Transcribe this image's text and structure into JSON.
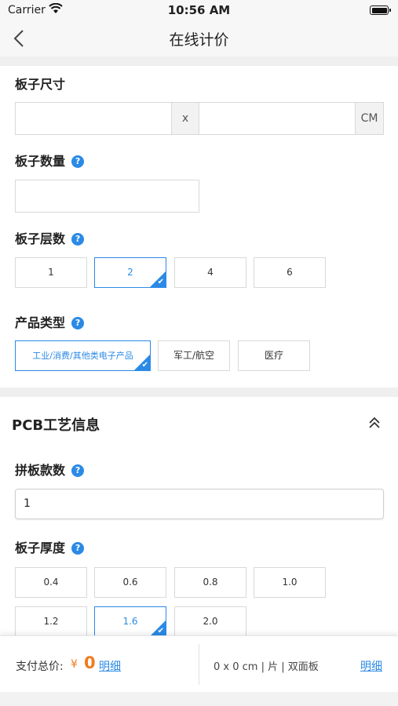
{
  "status_bar": {
    "carrier": "Carrier",
    "time": "10:56 AM"
  },
  "nav": {
    "title": "在线计价"
  },
  "board_size": {
    "label": "板子尺寸",
    "separator": "x",
    "unit": "CM",
    "width_value": "",
    "height_value": ""
  },
  "board_quantity": {
    "label": "板子数量",
    "value": ""
  },
  "board_layers": {
    "label": "板子层数",
    "options": [
      "1",
      "2",
      "4",
      "6"
    ],
    "selected": "2"
  },
  "product_type": {
    "label": "产品类型",
    "options": [
      "工业/消费/其他类电子产品",
      "军工/航空",
      "医疗"
    ],
    "selected": "工业/消费/其他类电子产品"
  },
  "pcb_section": {
    "title": "PCB工艺信息"
  },
  "panel_count": {
    "label": "拼板款数",
    "value": "1"
  },
  "board_thickness": {
    "label": "板子厚度",
    "options": [
      "0.4",
      "0.6",
      "0.8",
      "1.0",
      "1.2",
      "1.6",
      "2.0"
    ],
    "selected": "1.6"
  },
  "bottom_bar": {
    "total_label": "支付总价:",
    "currency": "¥",
    "total_value": "0",
    "detail_label": "明细",
    "summary": "0 x 0 cm | 片 | 双面板",
    "summary_detail_label": "明细"
  },
  "colors": {
    "accent": "#2b8ae6",
    "price": "#f07b1d"
  }
}
